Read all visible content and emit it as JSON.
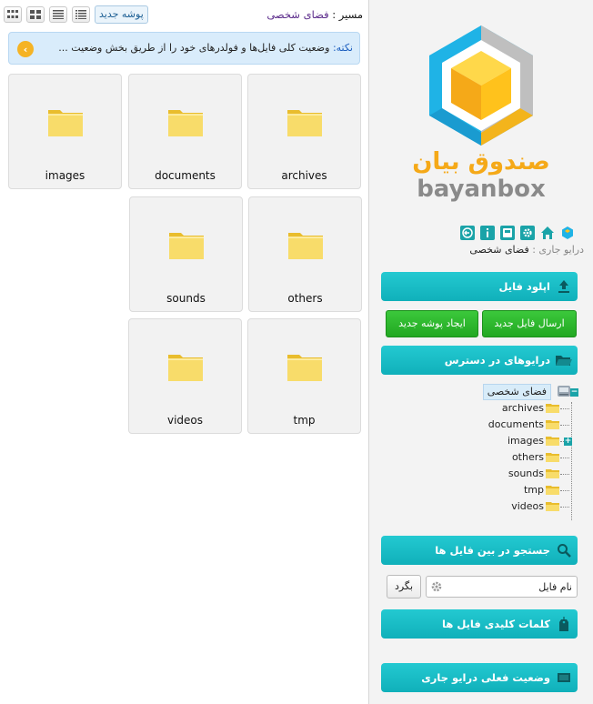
{
  "toolbar": {
    "new_folder_label": "پوشه جدید",
    "path_label": "مسیر :",
    "path_value": "فضای شخصی"
  },
  "note": {
    "label": "نکته:",
    "text": "وضعیت کلی فایل‌ها و فولدرهای خود را از طریق بخش وضعیت ..."
  },
  "folders": [
    "archives",
    "documents",
    "images",
    "others",
    "sounds",
    "tmp",
    "videos"
  ],
  "sidebar": {
    "logo_text_fa": "صندوق بیان",
    "logo_text_en": "bayanbox",
    "current_drive_label": "درایو جاری :",
    "current_drive_value": "فضای شخصی",
    "upload_section": "اپلود فایل",
    "send_file_button": "ارسال فایل جدید",
    "new_folder_button": "ایجاد پوشه جدید",
    "drives_section": "درایوهای در دسترس",
    "tree_root": "فضای شخصی",
    "tree_items": [
      "archives",
      "documents",
      "images",
      "others",
      "sounds",
      "tmp",
      "videos"
    ],
    "search_section": "جستجو در بین فایل ها",
    "search_placeholder": "نام فایل",
    "back_button": "بگرد",
    "keywords_section": "کلمات کلیدی فایل ها",
    "status_section": "وضعیت فعلی درایو جاری"
  },
  "colors": {
    "accent_teal": "#14b8c2",
    "button_green": "#2bb52b",
    "note_bg": "#d9ecfb",
    "folder_yellow": "#f6d75a"
  }
}
